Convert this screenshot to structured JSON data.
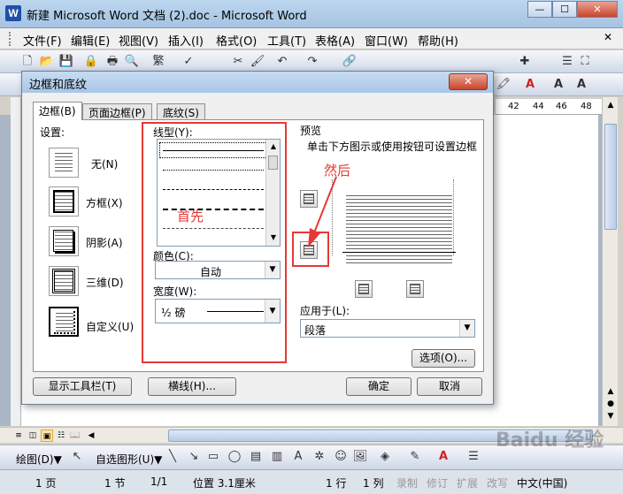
{
  "window": {
    "title": "新建 Microsoft Word 文档 (2).doc - Microsoft Word",
    "app_icon": "W"
  },
  "menu": {
    "items": [
      "文件(F)",
      "编辑(E)",
      "视图(V)",
      "插入(I)",
      "格式(O)",
      "工具(T)",
      "表格(A)",
      "窗口(W)",
      "帮助(H)"
    ]
  },
  "toolbar2": {
    "ruler_marks": [
      "42",
      "44",
      "46",
      "48"
    ]
  },
  "dialog": {
    "title": "边框和底纹",
    "close": "✕",
    "tabs": [
      "边框(B)",
      "页面边框(P)",
      "底纹(S)"
    ],
    "settings_label": "设置:",
    "settings": [
      "无(N)",
      "方框(X)",
      "阴影(A)",
      "三维(D)",
      "自定义(U)"
    ],
    "style_label": "线型(Y):",
    "color_label": "颜色(C):",
    "color_value": "自动",
    "width_label": "宽度(W):",
    "width_value": "½ 磅",
    "preview_label": "预览",
    "preview_hint": "单击下方图示或使用按钮可设置边框",
    "apply_label": "应用于(L):",
    "apply_value": "段落",
    "options_button": "选项(O)...",
    "show_toolbar_button": "显示工具栏(T)",
    "hline_button": "横线(H)...",
    "ok_button": "确定",
    "cancel_button": "取消"
  },
  "annotations": {
    "first": "首先",
    "then": "然后",
    "color": "#e53935"
  },
  "drawbar": {
    "draw_label": "绘图(D)▼",
    "autoshape_label": "自选图形(U)▼"
  },
  "status": {
    "page": "1 页",
    "section": "1 节",
    "pages": "1/1",
    "position": "位置 3.1厘米",
    "line": "1 行",
    "col": "1 列",
    "rec": "录制",
    "rev": "修订",
    "ext": "扩展",
    "ovr": "改写",
    "lang": "中文(中国)"
  },
  "watermark": "Baidu 经验"
}
